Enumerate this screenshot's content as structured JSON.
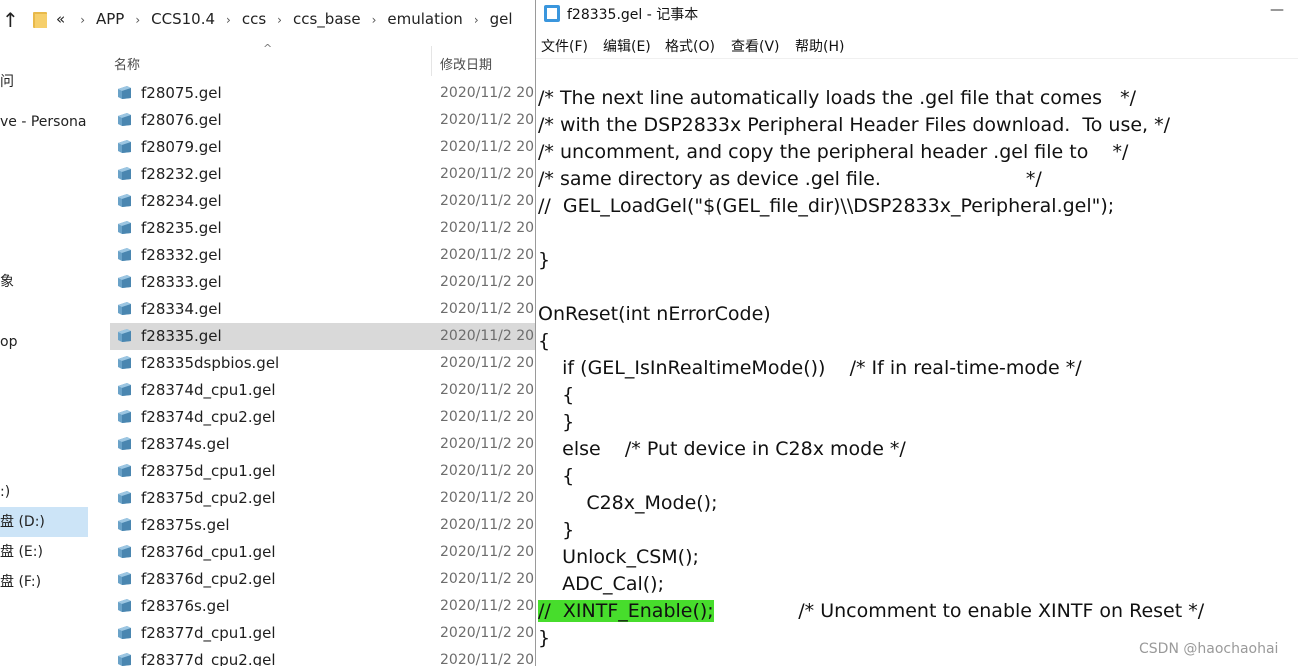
{
  "explorer": {
    "breadcrumbs": [
      "«",
      "APP",
      "CCS10.4",
      "ccs",
      "ccs_base",
      "emulation",
      "gel"
    ],
    "nav_items": [
      "问",
      "ve - Persona",
      "象",
      "op",
      ":)",
      "盘 (D:)",
      "盘 (E:)",
      "盘 (F:)"
    ],
    "columns": {
      "name": "名称",
      "date": "修改日期"
    },
    "files": [
      {
        "name": "f28075.gel",
        "date": "2020/11/2 20"
      },
      {
        "name": "f28076.gel",
        "date": "2020/11/2 20"
      },
      {
        "name": "f28079.gel",
        "date": "2020/11/2 20"
      },
      {
        "name": "f28232.gel",
        "date": "2020/11/2 20"
      },
      {
        "name": "f28234.gel",
        "date": "2020/11/2 20"
      },
      {
        "name": "f28235.gel",
        "date": "2020/11/2 20"
      },
      {
        "name": "f28332.gel",
        "date": "2020/11/2 20"
      },
      {
        "name": "f28333.gel",
        "date": "2020/11/2 20"
      },
      {
        "name": "f28334.gel",
        "date": "2020/11/2 20"
      },
      {
        "name": "f28335.gel",
        "date": "2020/11/2 20"
      },
      {
        "name": "f28335dspbios.gel",
        "date": "2020/11/2 20"
      },
      {
        "name": "f28374d_cpu1.gel",
        "date": "2020/11/2 20"
      },
      {
        "name": "f28374d_cpu2.gel",
        "date": "2020/11/2 20"
      },
      {
        "name": "f28374s.gel",
        "date": "2020/11/2 20"
      },
      {
        "name": "f28375d_cpu1.gel",
        "date": "2020/11/2 20"
      },
      {
        "name": "f28375d_cpu2.gel",
        "date": "2020/11/2 20"
      },
      {
        "name": "f28375s.gel",
        "date": "2020/11/2 20"
      },
      {
        "name": "f28376d_cpu1.gel",
        "date": "2020/11/2 20"
      },
      {
        "name": "f28376d_cpu2.gel",
        "date": "2020/11/2 20"
      },
      {
        "name": "f28376s.gel",
        "date": "2020/11/2 20"
      },
      {
        "name": "f28377d_cpu1.gel",
        "date": "2020/11/2 20"
      },
      {
        "name": "f28377d_cpu2.gel",
        "date": "2020/11/2 20"
      }
    ],
    "selected_file": "f28335.gel",
    "selected_nav": "盘 (D:)"
  },
  "notepad": {
    "title": "f28335.gel - 记事本",
    "minimize_glyph": "—",
    "menu": [
      "文件(F)",
      "编辑(E)",
      "格式(O)",
      "查看(V)",
      "帮助(H)"
    ],
    "code_lines": [
      "/* The next line automatically loads the .gel file that comes   */",
      "/* with the DSP2833x Peripheral Header Files download.  To use, */",
      "/* uncomment, and copy the peripheral header .gel file to    */",
      "/* same directory as device .gel file.                        */",
      "//  GEL_LoadGel(\"$(GEL_file_dir)\\\\DSP2833x_Peripheral.gel\");",
      "",
      "}",
      "",
      "OnReset(int nErrorCode)",
      "{",
      "    if (GEL_IsInRealtimeMode())    /* If in real-time-mode */",
      "    {",
      "    }",
      "    else    /* Put device in C28x mode */",
      "    {",
      "        C28x_Mode();",
      "    }",
      "    Unlock_CSM();",
      "    ADC_Cal();",
      "}"
    ],
    "highlighted_line": {
      "highlight": "//  XINTF_Enable();",
      "rest": "              /* Uncomment to enable XINTF on Reset */"
    }
  },
  "watermark": "CSDN @haochaohai",
  "colors": {
    "highlight": "#47dd2c",
    "selection": "#d9d9d9",
    "nav_selection": "#cce4f7"
  }
}
